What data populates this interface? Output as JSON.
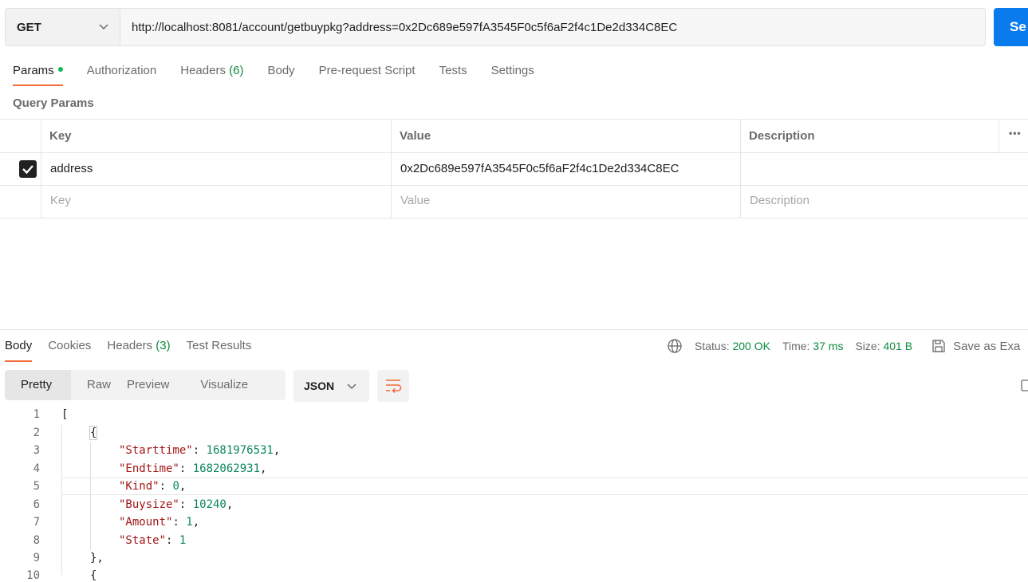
{
  "request": {
    "method": "GET",
    "url": "http://localhost:8081/account/getbuypkg?address=0x2Dc689e597fA3545F0c5f6aF2f4c1De2d334C8EC",
    "send_label": "Se"
  },
  "request_tabs": [
    {
      "label": "Params",
      "count": "",
      "active": true
    },
    {
      "label": "Authorization",
      "count": ""
    },
    {
      "label": "Headers",
      "count": "(6)"
    },
    {
      "label": "Body",
      "count": ""
    },
    {
      "label": "Pre-request Script",
      "count": ""
    },
    {
      "label": "Tests",
      "count": ""
    },
    {
      "label": "Settings",
      "count": ""
    }
  ],
  "query_params": {
    "title": "Query Params",
    "columns": [
      "Key",
      "Value",
      "Description"
    ],
    "rows": [
      {
        "checked": true,
        "key": "address",
        "value": "0x2Dc689e597fA3545F0c5f6aF2f4c1De2d334C8EC",
        "description": ""
      }
    ],
    "placeholder": {
      "key": "Key",
      "value": "Value",
      "description": "Description"
    },
    "more_label": "•••"
  },
  "response_tabs": [
    {
      "label": "Body",
      "count": "",
      "active": true
    },
    {
      "label": "Cookies",
      "count": ""
    },
    {
      "label": "Headers",
      "count": "(3)"
    },
    {
      "label": "Test Results",
      "count": ""
    }
  ],
  "status": {
    "status_label": "Status:",
    "status_value": "200 OK",
    "time_label": "Time:",
    "time_value": "37 ms",
    "size_label": "Size:",
    "size_value": "401 B",
    "save_label": "Save as Exa"
  },
  "format_tabs": [
    "Pretty",
    "Raw",
    "Preview",
    "Visualize"
  ],
  "format_selected": "Pretty",
  "language": "JSON",
  "code_lines": [
    {
      "num": "1",
      "indent": 0,
      "text": "["
    },
    {
      "num": "2",
      "indent": 1,
      "text": "{"
    },
    {
      "num": "3",
      "indent": 2,
      "key": "\"Starttime\"",
      "value": "1681976531",
      "tail": ","
    },
    {
      "num": "4",
      "indent": 2,
      "key": "\"Endtime\"",
      "value": "1682062931",
      "tail": ","
    },
    {
      "num": "5",
      "indent": 2,
      "key": "\"Kind\"",
      "value": "0",
      "tail": ","
    },
    {
      "num": "6",
      "indent": 2,
      "key": "\"Buysize\"",
      "value": "10240",
      "tail": ","
    },
    {
      "num": "7",
      "indent": 2,
      "key": "\"Amount\"",
      "value": "1",
      "tail": ","
    },
    {
      "num": "8",
      "indent": 2,
      "key": "\"State\"",
      "value": "1",
      "tail": ""
    },
    {
      "num": "9",
      "indent": 1,
      "text": "},"
    },
    {
      "num": "10",
      "indent": 1,
      "text": "{"
    }
  ],
  "colors": {
    "accent": "#f26b3a",
    "send": "#097bed",
    "success": "#0d8a3f",
    "json_key": "#a31515",
    "json_number": "#098658"
  }
}
